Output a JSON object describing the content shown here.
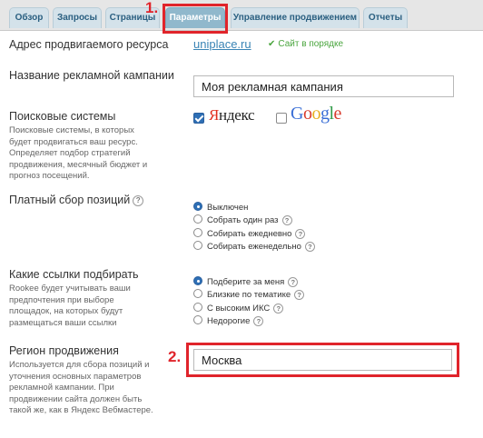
{
  "tabs": [
    {
      "label": "Обзор"
    },
    {
      "label": "Запросы"
    },
    {
      "label": "Страницы"
    },
    {
      "label": "Параметры"
    },
    {
      "label": "Управление продвижением"
    },
    {
      "label": "Отчеты"
    }
  ],
  "markers": {
    "step1": "1.",
    "step2": "2."
  },
  "resource": {
    "label": "Адрес продвигаемого ресурса",
    "url": "uniplace.ru",
    "status": "Сайт в порядке"
  },
  "campaign": {
    "label": "Название рекламной кампании",
    "value": "Моя рекламная кампания"
  },
  "search_engines": {
    "label": "Поисковые системы",
    "description": "Поисковые системы, в которых будет продвигаться ваш ресурс. Определяет подбор стратегий продвижения, месячный бюджет и прогноз посещений.",
    "yandex": {
      "logo_text": "Яндекс",
      "checked": true
    },
    "google": {
      "logo_text": "Google",
      "checked": false
    }
  },
  "paid_positions": {
    "label": "Платный сбор позиций",
    "options": [
      {
        "label": "Выключен",
        "selected": true
      },
      {
        "label": "Собрать один раз",
        "selected": false
      },
      {
        "label": "Собирать ежедневно",
        "selected": false
      },
      {
        "label": "Собирать еженедельно",
        "selected": false
      }
    ]
  },
  "links": {
    "label": "Какие ссылки подбирать",
    "description": "Rookee будет учитывать ваши предпочтения при выборе площадок, на которых будут размещаться ваши ссылки",
    "options": [
      {
        "label": "Подберите за меня",
        "selected": true
      },
      {
        "label": "Близкие по тематике",
        "selected": false
      },
      {
        "label": "С высоким ИКС",
        "selected": false
      },
      {
        "label": "Недорогие",
        "selected": false
      }
    ]
  },
  "region": {
    "label": "Регион продвижения",
    "description": "Используется для сбора позиций и уточнения основных параметров рекламной кампании. При продвижении сайта должен быть такой же, как в Яндекс Вебмастере.",
    "value": "Москва"
  },
  "help_symbol": "?",
  "colors": {
    "tab": "#d4e2ea",
    "tab_active": "#90b8cc",
    "highlight": "#e0242b",
    "link": "#3a84b5",
    "status_ok": "#4aa53e",
    "checkbox_on": "#2e6fb5"
  }
}
